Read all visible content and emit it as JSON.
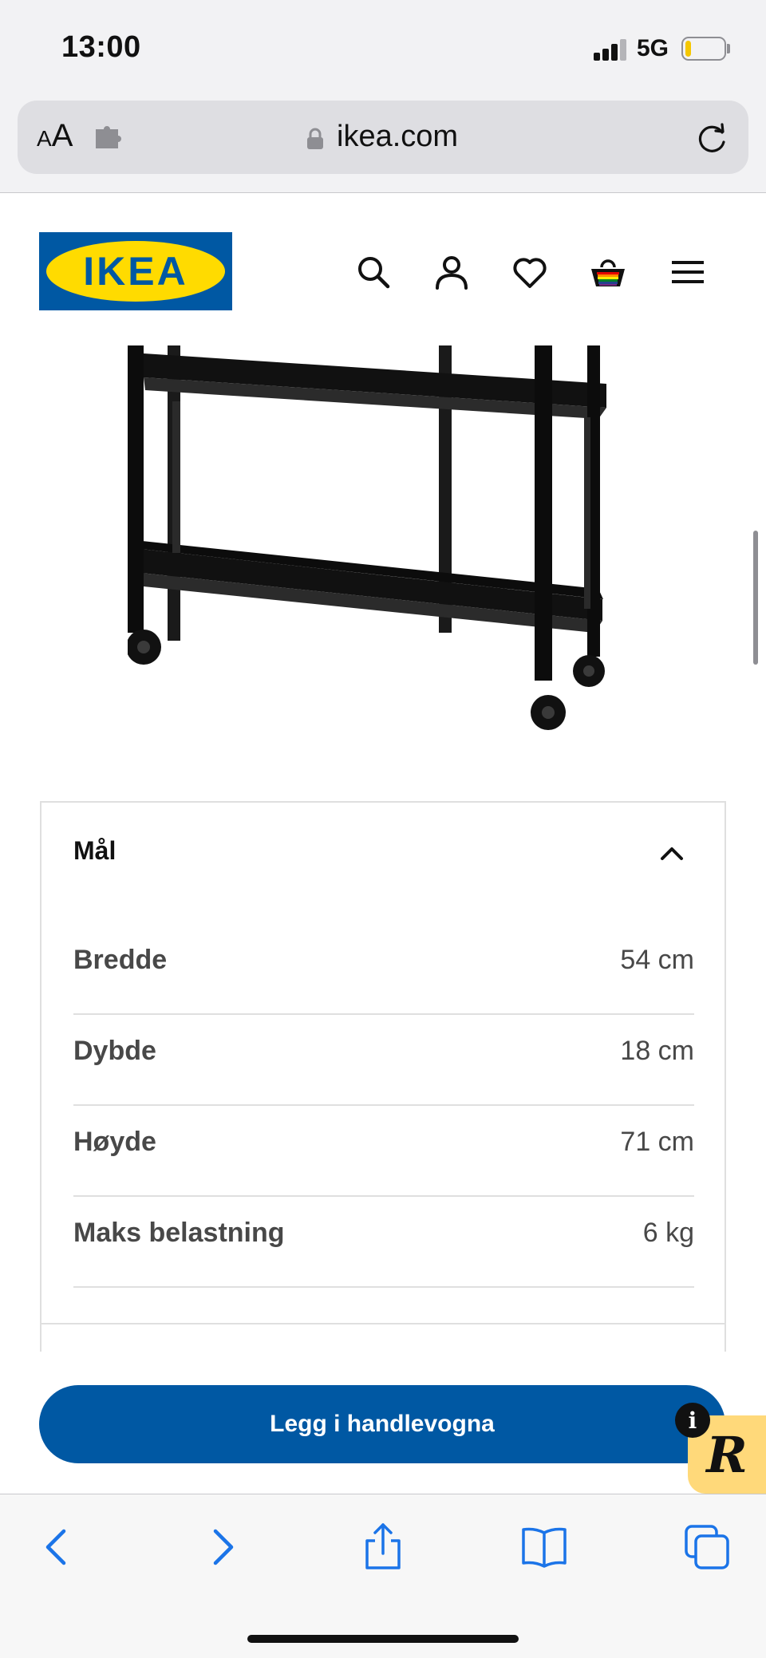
{
  "status_bar": {
    "time": "13:00",
    "network": "5G",
    "signal_bars_active": 3,
    "signal_bars_total": 4,
    "battery_level": 0.15
  },
  "browser": {
    "text_size_label_small": "A",
    "text_size_label_large": "A",
    "url": "ikea.com",
    "icons": [
      "puzzle-extension-icon",
      "lock-icon",
      "reload-icon"
    ]
  },
  "header": {
    "logo_text": "IKEA",
    "icons": [
      "search-icon",
      "account-icon",
      "heart-icon",
      "basket-icon",
      "menu-icon"
    ],
    "colors": {
      "logo_blue": "#0058a3",
      "logo_yellow": "#ffdb00"
    }
  },
  "dimensions": {
    "title": "Mål",
    "expanded": true,
    "rows": [
      {
        "label": "Bredde",
        "value": "54 cm"
      },
      {
        "label": "Dybde",
        "value": "18 cm"
      },
      {
        "label": "Høyde",
        "value": "71 cm"
      },
      {
        "label": "Maks belastning",
        "value": "6 kg"
      }
    ]
  },
  "cart": {
    "button_label": "Legg i handlevogna",
    "info_badge": "i",
    "widget_letter": "R",
    "colors": {
      "button": "#0058a3"
    }
  },
  "toolbar": {
    "icons": [
      "back-icon",
      "forward-icon",
      "share-icon",
      "bookmarks-icon",
      "tabs-icon"
    ],
    "accent": "#1b74e8"
  }
}
